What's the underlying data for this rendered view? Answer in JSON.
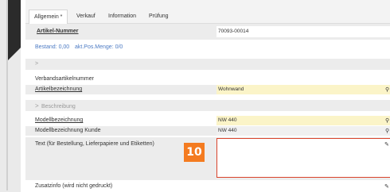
{
  "tabs": [
    {
      "label": "Allgemein *"
    },
    {
      "label": "Verkauf"
    },
    {
      "label": "Information"
    },
    {
      "label": "Prüfung"
    }
  ],
  "article_number": {
    "label": "Artikel-Nummer",
    "value": "70093-00014"
  },
  "stock": {
    "bestand": "Bestand: 0,00",
    "menge": "akt.Pos.Menge: 0/0"
  },
  "section_collapsed_1": {
    "chevron": ">"
  },
  "fields_top": {
    "verbandsartikelnummer": "Verbandsartikelnummer",
    "artikelbezeichnung": {
      "label": "Artikelbezeichnung",
      "value": "Wohnwand"
    }
  },
  "section_description": {
    "chevron": ">",
    "title": "Beschreibung"
  },
  "fields_desc": {
    "modellbezeichnung": {
      "label": "Modellbezeichnung",
      "value": "NW 440"
    },
    "modellbezeichnung_kunde": {
      "label": "Modellbezeichnung Kunde",
      "value": "NW 440"
    },
    "text_label": "Text (für Bestellung, Lieferpapiere und Etiketten)",
    "zusatzinfo": "Zusatzinfo (wird nicht gedruckt)"
  },
  "step_badge": "10",
  "colors": {
    "highlight": "#fbf4c8",
    "focus_border": "#d9432b",
    "badge": "#f47b20",
    "link": "#4d7bc4"
  }
}
